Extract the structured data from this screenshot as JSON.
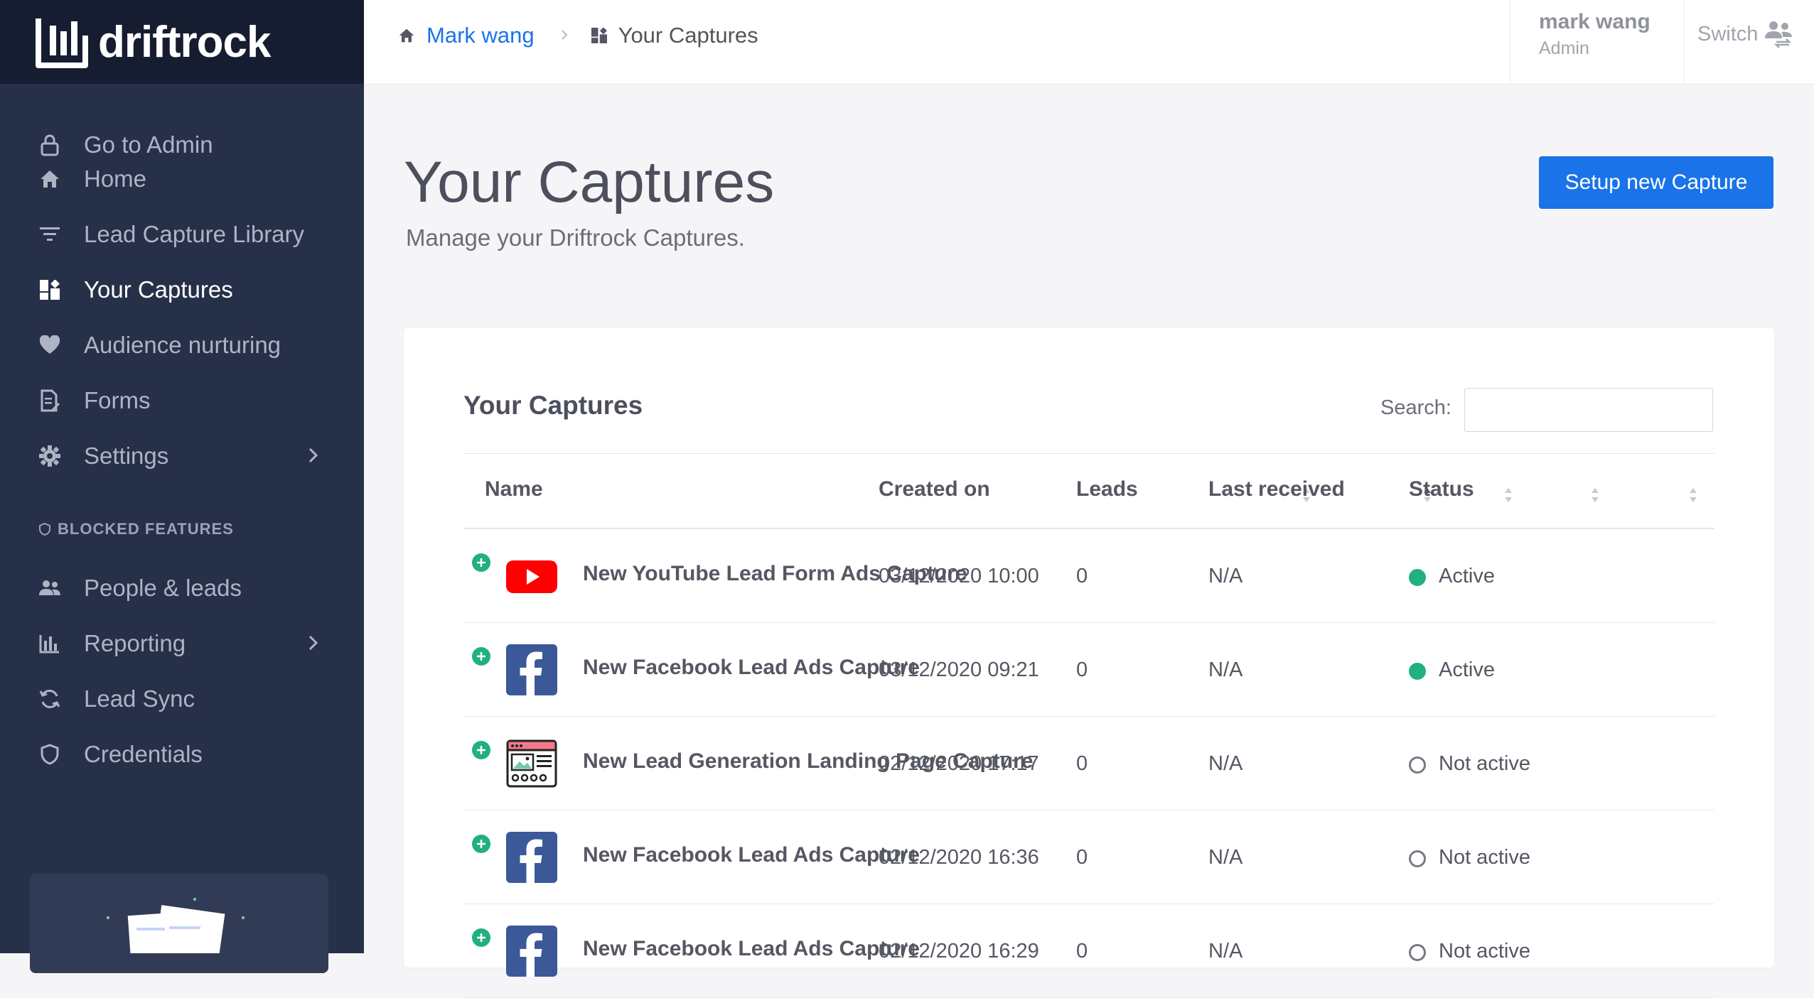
{
  "brand": {
    "name": "driftrock"
  },
  "sidebar": {
    "items": [
      {
        "label": "Go to Admin",
        "icon": "lock-icon"
      },
      {
        "label": "Home",
        "icon": "home-icon"
      },
      {
        "label": "Lead Capture Library",
        "icon": "filter-icon"
      },
      {
        "label": "Your Captures",
        "icon": "dashboard-icon",
        "active": true
      },
      {
        "label": "Audience nurturing",
        "icon": "heart-icon"
      },
      {
        "label": "Forms",
        "icon": "form-icon"
      },
      {
        "label": "Settings",
        "icon": "gear-icon",
        "has_submenu": true
      }
    ],
    "blocked_section_label": "BLOCKED FEATURES",
    "blocked_items": [
      {
        "label": "People & leads",
        "icon": "people-icon"
      },
      {
        "label": "Reporting",
        "icon": "bar-chart-icon",
        "has_submenu": true
      },
      {
        "label": "Lead Sync",
        "icon": "sync-icon"
      },
      {
        "label": "Credentials",
        "icon": "shield-icon"
      }
    ]
  },
  "breadcrumb": {
    "home_label": "Mark wang",
    "current_label": "Your Captures"
  },
  "user": {
    "name": "mark wang",
    "role": "Admin",
    "switch_label": "Switch"
  },
  "page": {
    "title": "Your Captures",
    "subtitle": "Manage your Driftrock Captures.",
    "primary_button": "Setup new Capture"
  },
  "table": {
    "title": "Your Captures",
    "search_label": "Search:",
    "search_value": "",
    "columns": [
      "Name",
      "Created on",
      "Leads",
      "Last received",
      "Status"
    ],
    "sorted_column": "Created on",
    "rows": [
      {
        "source": "youtube",
        "name": "New YouTube Lead Form Ads Capture",
        "created": "03/12/2020 10:00",
        "leads": "0",
        "last_received": "N/A",
        "status": "Active"
      },
      {
        "source": "facebook",
        "name": "New Facebook Lead Ads Capture",
        "created": "03/12/2020 09:21",
        "leads": "0",
        "last_received": "N/A",
        "status": "Active"
      },
      {
        "source": "landing-page",
        "name": "New Lead Generation Landing Page Capture",
        "created": "02/12/2020 17:17",
        "leads": "0",
        "last_received": "N/A",
        "status": "Not active"
      },
      {
        "source": "facebook",
        "name": "New Facebook Lead Ads Capture",
        "created": "02/12/2020 16:36",
        "leads": "0",
        "last_received": "N/A",
        "status": "Not active"
      },
      {
        "source": "facebook",
        "name": "New Facebook Lead Ads Capture",
        "created": "02/12/2020 16:29",
        "leads": "0",
        "last_received": "N/A",
        "status": "Not active"
      }
    ]
  },
  "colors": {
    "accent": "#1a73e8",
    "sidebar": "#273049",
    "brand_bar": "#171d30",
    "active_status": "#22b07d"
  }
}
